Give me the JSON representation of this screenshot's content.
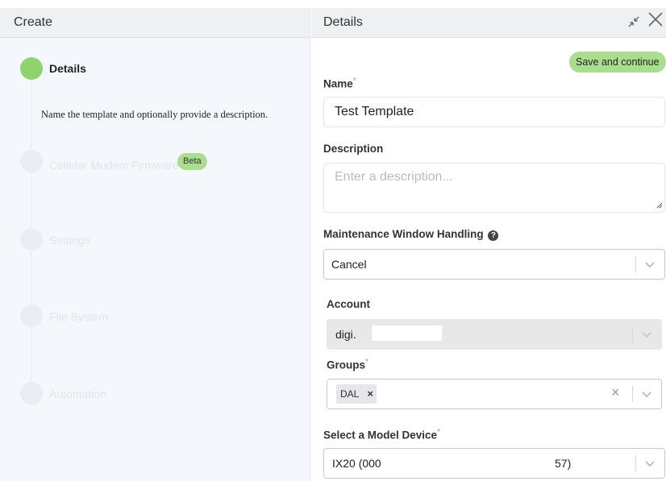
{
  "left": {
    "header": "Create",
    "steps": [
      {
        "label": "Details",
        "active": true
      },
      {
        "label": "Cellular Modem Firmware",
        "active": false
      },
      {
        "label": "Settings",
        "active": false
      },
      {
        "label": "File System",
        "active": false
      },
      {
        "label": "Automation",
        "active": false
      }
    ],
    "description": "Name the template and optionally provide a description.",
    "beta_badge": "Beta"
  },
  "right": {
    "header": "Details",
    "save_label": "Save and continue",
    "name": {
      "label": "Name",
      "required": "*",
      "value": "Test Template"
    },
    "description": {
      "label": "Description",
      "placeholder": "Enter a description..."
    },
    "maintenance": {
      "label": "Maintenance Window Handling",
      "help": "?",
      "value": "Cancel"
    },
    "account": {
      "label": "Account",
      "value": "digi."
    },
    "groups": {
      "label": "Groups",
      "required": "*",
      "tags": [
        "DAL"
      ]
    },
    "model_device": {
      "label": "Select a Model Device",
      "required": "*",
      "value_left": "IX20 (000",
      "value_right": "57)"
    }
  },
  "colors": {
    "accent_green": "#8fd36b",
    "button_green": "#a9df8c",
    "left_bg": "#f4f8fd",
    "header_bg": "#eef0f2"
  },
  "icons": [
    "collapse-icon",
    "close-icon",
    "help-icon",
    "chevron-down-icon",
    "clear-icon",
    "tag-remove-icon",
    "resize-handle-icon"
  ]
}
